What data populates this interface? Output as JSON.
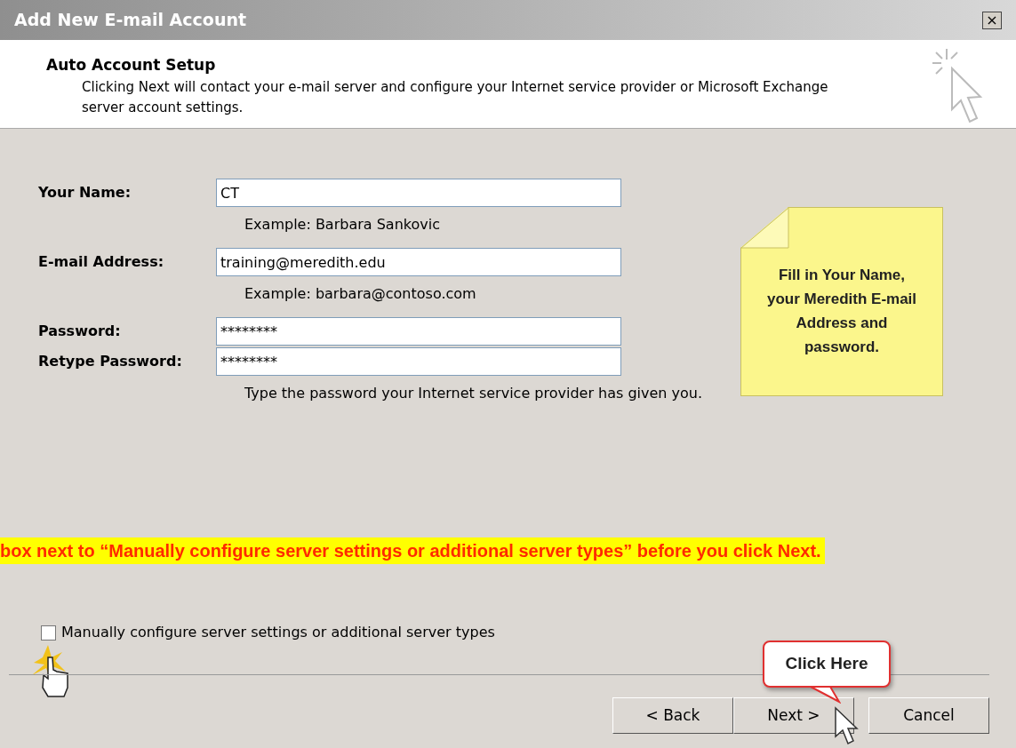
{
  "window": {
    "title": "Add New E-mail Account",
    "close": "×"
  },
  "header": {
    "title": "Auto Account Setup",
    "description": "Clicking Next will contact your e-mail server and configure your Internet service provider or Microsoft Exchange server account settings."
  },
  "fields": [
    {
      "label": "Your Name:",
      "value": "CT",
      "hint": "Example: Barbara Sankovic"
    },
    {
      "label": "E-mail Address:",
      "value": "training@meredith.edu",
      "hint": "Example: barbara@contoso.com"
    },
    {
      "label": "Password:",
      "value": "********"
    },
    {
      "label": "Retype Password:",
      "value": "********",
      "hint": "Type the password your Internet service provider has given you."
    }
  ],
  "note": "Fill in Your Name, your Meredith E-mail Address and password.",
  "banner": "box next to “Manually configure server settings or additional server types” before you click Next.",
  "checkbox": {
    "label": "Manually configure server settings or additional server types",
    "checked": false
  },
  "callout": "Click Here",
  "buttons": [
    {
      "label": "< Back"
    },
    {
      "label": "Next >"
    },
    {
      "label": "Cancel"
    }
  ]
}
